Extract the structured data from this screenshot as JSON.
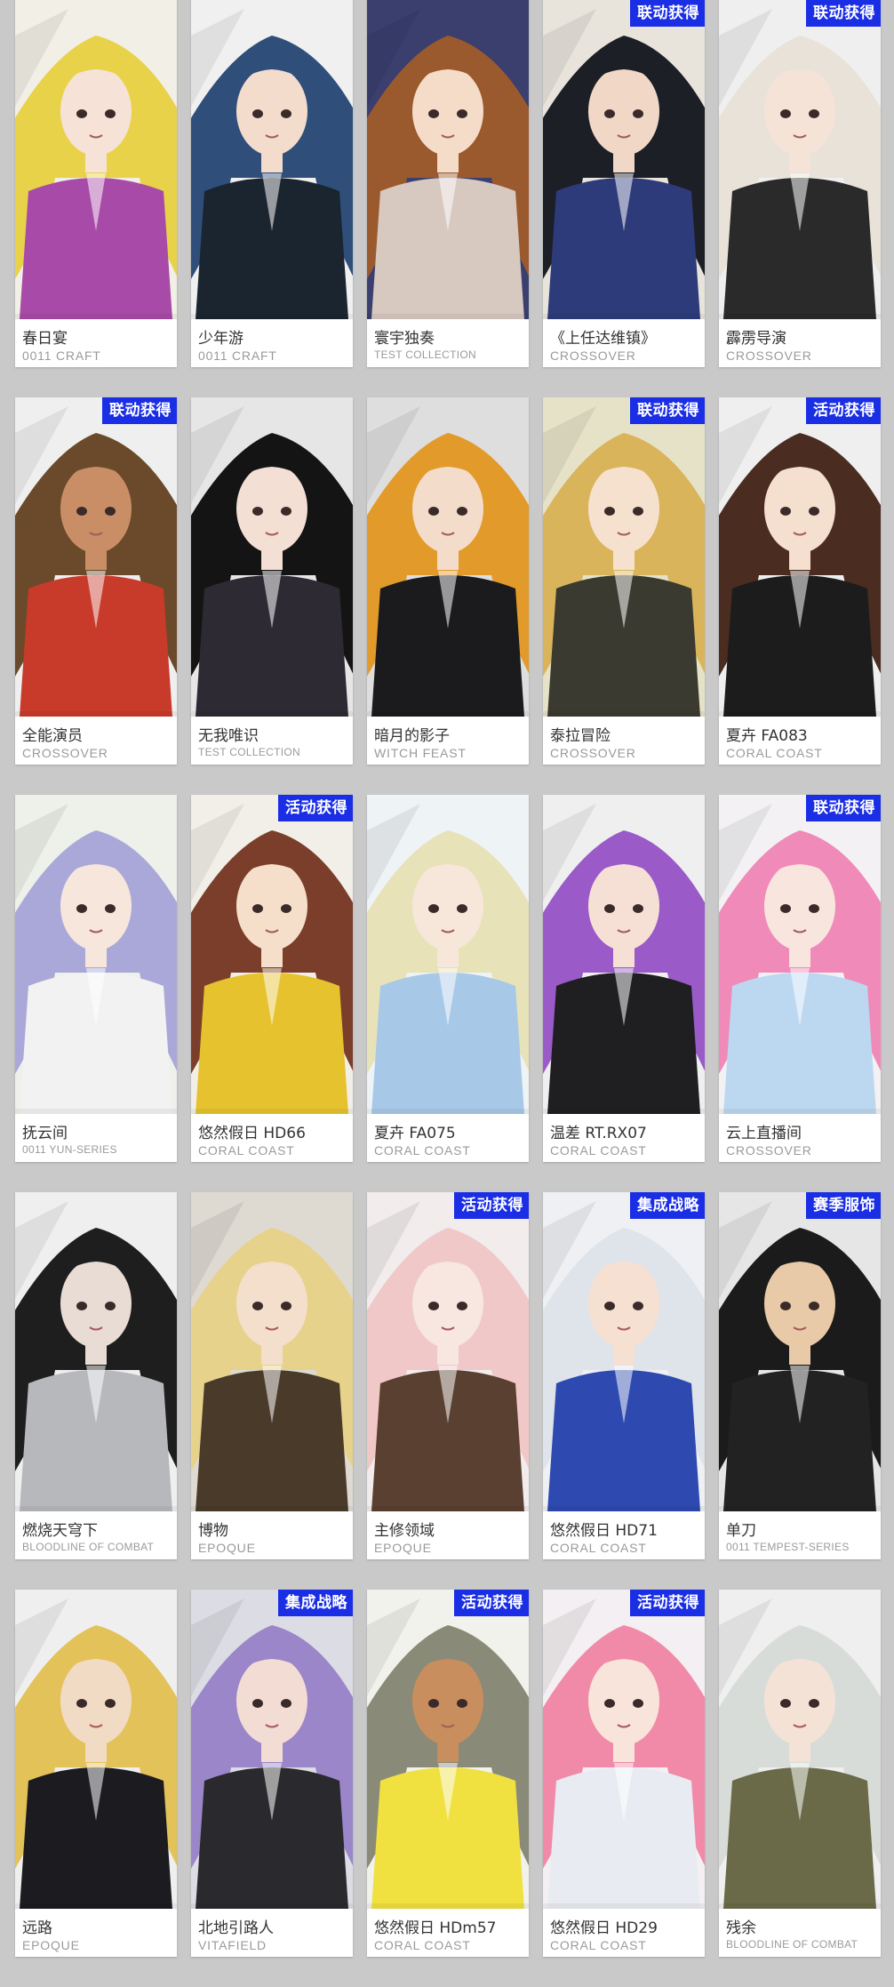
{
  "colors": {
    "background": "#c9c9c9",
    "badge": "#1a2ee6",
    "card": "#ffffff"
  },
  "cards": [
    {
      "name": "春日宴",
      "series": "0011 CRAFT",
      "badge": "",
      "hair": "#e8d24a",
      "coat": "#a84aa8",
      "bg": "#f1efe6",
      "skin": "#f6e2d6"
    },
    {
      "name": "少年游",
      "series": "0011 CRAFT",
      "badge": "",
      "hair": "#2f4f7a",
      "coat": "#1b2530",
      "bg": "#f0f0f0",
      "skin": "#f3dccc"
    },
    {
      "name": "寰宇独奏",
      "series": "TEST COLLECTION",
      "badge": "",
      "hair": "#9a5a2e",
      "coat": "#d7c8c0",
      "bg": "#3a3f6e",
      "skin": "#f4dcc8"
    },
    {
      "name": "《上任达维镇》",
      "series": "CROSSOVER",
      "badge": "联动获得",
      "hair": "#1d1f26",
      "coat": "#2d3b7a",
      "bg": "#e8e4dc",
      "skin": "#f1d7c6"
    },
    {
      "name": "霹雳导演",
      "series": "CROSSOVER",
      "badge": "联动获得",
      "hair": "#e9e2d8",
      "coat": "#2a2a2a",
      "bg": "#efefef",
      "skin": "#f6e3d8"
    },
    {
      "name": "全能演员",
      "series": "CROSSOVER",
      "badge": "联动获得",
      "hair": "#6a4a2a",
      "coat": "#c83a2a",
      "bg": "#efefef",
      "skin": "#c98e66"
    },
    {
      "name": "无我唯识",
      "series": "TEST COLLECTION",
      "badge": "",
      "hair": "#141414",
      "coat": "#2e2a34",
      "bg": "#e6e6e6",
      "skin": "#f3dfd4"
    },
    {
      "name": "暗月的影子",
      "series": "WITCH FEAST",
      "badge": "",
      "hair": "#e29a2a",
      "coat": "#1b1b1e",
      "bg": "#dedede",
      "skin": "#f4dccb"
    },
    {
      "name": "泰拉冒险",
      "series": "CROSSOVER",
      "badge": "联动获得",
      "hair": "#d9b45a",
      "coat": "#3a3a30",
      "bg": "#e6e2c8",
      "skin": "#f6e1cf"
    },
    {
      "name": "夏卉 FA083",
      "series": "CORAL COAST",
      "badge": "活动获得",
      "hair": "#4a2c20",
      "coat": "#1c1c1c",
      "bg": "#efefef",
      "skin": "#f5dfcf"
    },
    {
      "name": "抚云间",
      "series": "0011 YUN-SERIES",
      "badge": "",
      "hair": "#a9a8d8",
      "coat": "#f2f2f2",
      "bg": "#eef0ea",
      "skin": "#f7e6dc"
    },
    {
      "name": "悠然假日 HD66",
      "series": "CORAL COAST",
      "badge": "活动获得",
      "hair": "#7a3e2a",
      "coat": "#e6c22e",
      "bg": "#f1efe8",
      "skin": "#f6dfca"
    },
    {
      "name": "夏卉 FA075",
      "series": "CORAL COAST",
      "badge": "",
      "hair": "#e8e2b8",
      "coat": "#a8c8e8",
      "bg": "#eef3f6",
      "skin": "#f7e6da"
    },
    {
      "name": "温差 RT.RX07",
      "series": "CORAL COAST",
      "badge": "",
      "hair": "#9a5ac8",
      "coat": "#1f1f22",
      "bg": "#efefef",
      "skin": "#f6e0d6"
    },
    {
      "name": "云上直播间",
      "series": "CROSSOVER",
      "badge": "联动获得",
      "hair": "#f08ab8",
      "coat": "#bcd8f0",
      "bg": "#f3f1f4",
      "skin": "#f8e6de"
    },
    {
      "name": "燃烧天穹下",
      "series": "BLOODLINE OF COMBAT",
      "badge": "",
      "hair": "#1e1e1e",
      "coat": "#b6b8bc",
      "bg": "#efefef",
      "skin": "#e8dcd4"
    },
    {
      "name": "博物",
      "series": "EPOQUE",
      "badge": "",
      "hair": "#e6d28a",
      "coat": "#4a3a2a",
      "bg": "#dedad2",
      "skin": "#f4dfcc"
    },
    {
      "name": "主修领域",
      "series": "EPOQUE",
      "badge": "活动获得",
      "hair": "#f0c8c8",
      "coat": "#5a4030",
      "bg": "#f2ecec",
      "skin": "#f8e6e0"
    },
    {
      "name": "悠然假日 HD71",
      "series": "CORAL COAST",
      "badge": "集成战略",
      "hair": "#dfe4ea",
      "coat": "#2e4ab0",
      "bg": "#eef0f4",
      "skin": "#f5e0d2"
    },
    {
      "name": "单刀",
      "series": "0011 TEMPEST-SERIES",
      "badge": "赛季服饰",
      "hair": "#1b1b1b",
      "coat": "#222222",
      "bg": "#e6e6e6",
      "skin": "#e9caa8"
    },
    {
      "name": "远路",
      "series": "EPOQUE",
      "badge": "",
      "hair": "#e3c25a",
      "coat": "#1c1c20",
      "bg": "#efefef",
      "skin": "#f2dbc4"
    },
    {
      "name": "北地引路人",
      "series": "VITAFIELD",
      "badge": "集成战略",
      "hair": "#9a86c8",
      "coat": "#2a2a2e",
      "bg": "#dcdce4",
      "skin": "#f2dcd4"
    },
    {
      "name": "悠然假日 HDm57",
      "series": "CORAL COAST",
      "badge": "活动获得",
      "hair": "#8a8a78",
      "coat": "#f0e040",
      "bg": "#f2f2ec",
      "skin": "#c88e5e"
    },
    {
      "name": "悠然假日 HD29",
      "series": "CORAL COAST",
      "badge": "活动获得",
      "hair": "#f08aa8",
      "coat": "#e8ecf2",
      "bg": "#f4eff2",
      "skin": "#f8e4da"
    },
    {
      "name": "残余",
      "series": "BLOODLINE OF COMBAT",
      "badge": "",
      "hair": "#d8dcd8",
      "coat": "#6a6a48",
      "bg": "#efefef",
      "skin": "#f5e2d6"
    }
  ]
}
